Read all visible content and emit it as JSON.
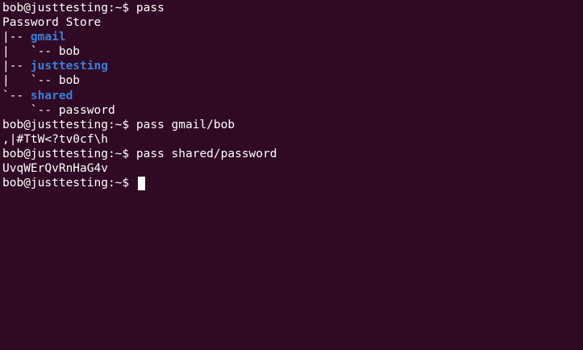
{
  "colors": {
    "background": "#300a24",
    "text": "#ffffff",
    "directory": "#3b7fd8"
  },
  "terminal": {
    "lines": [
      {
        "prompt": "bob@justtesting:~$",
        "cmd": "pass"
      },
      {
        "text": "Password Store"
      },
      {
        "prefix": "|-- ",
        "dir": "gmail"
      },
      {
        "text": "|   `-- bob"
      },
      {
        "prefix": "|-- ",
        "dir": "justtesting"
      },
      {
        "text": "|   `-- bob"
      },
      {
        "prefix": "`-- ",
        "dir": "shared"
      },
      {
        "text": "    `-- password"
      },
      {
        "prompt": "bob@justtesting:~$",
        "cmd": "pass gmail/bob"
      },
      {
        "text": ",|#TtW<?tv0cf\\h"
      },
      {
        "prompt": "bob@justtesting:~$",
        "cmd": "pass shared/password"
      },
      {
        "text": "UvqWErQvRnHaG4v"
      },
      {
        "prompt": "bob@justtesting:~$",
        "cmd": ""
      }
    ]
  }
}
